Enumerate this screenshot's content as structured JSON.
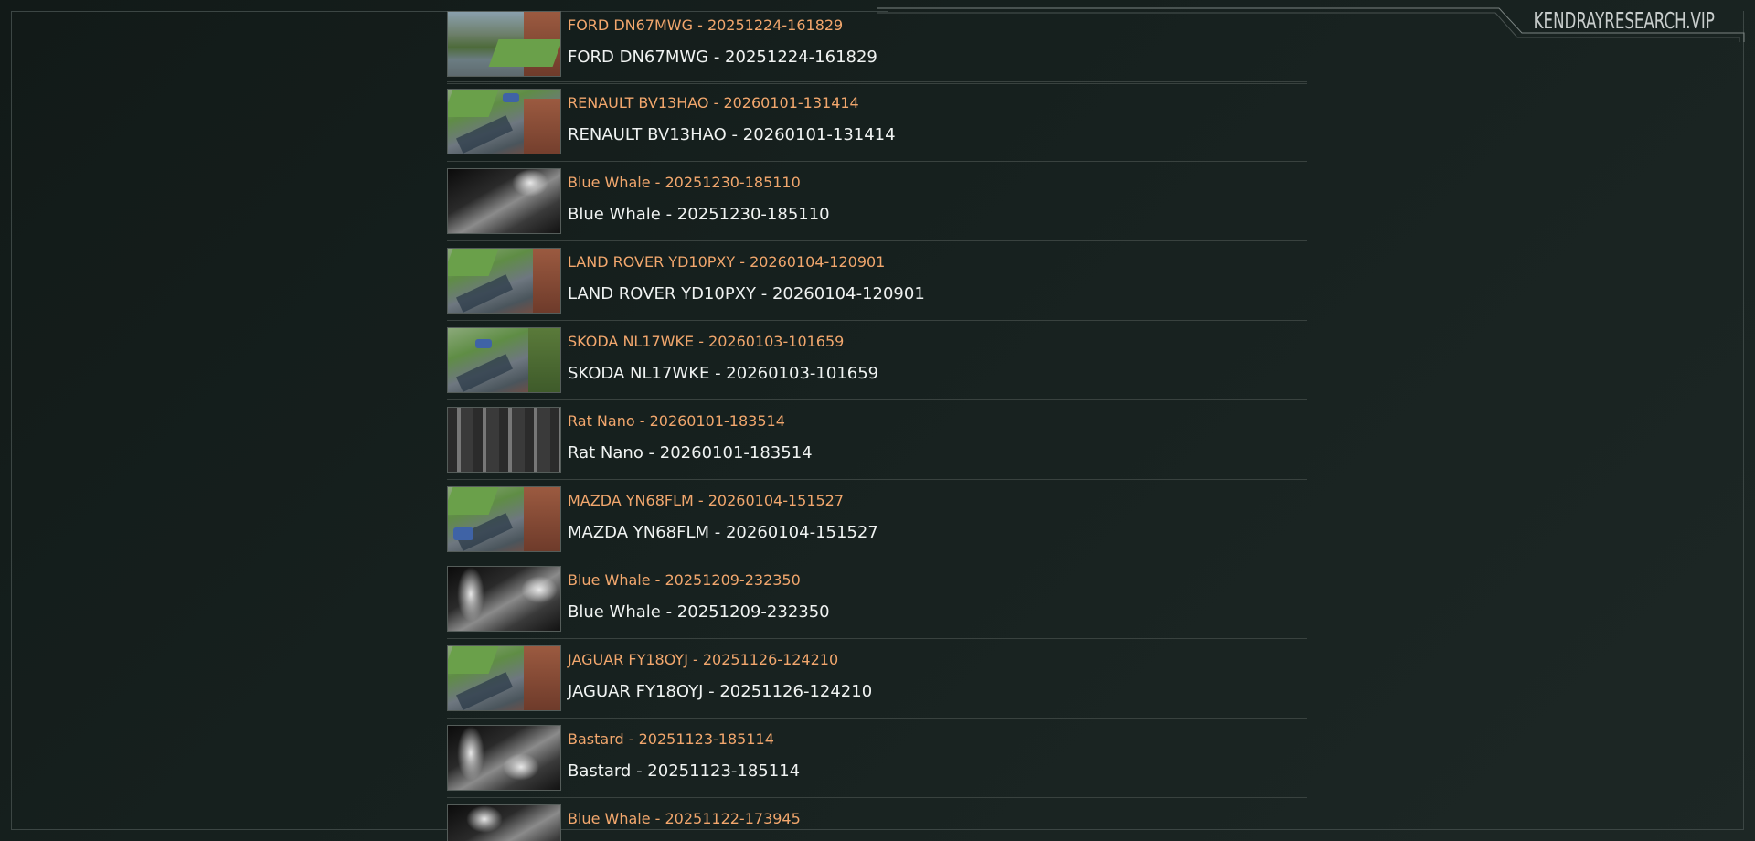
{
  "brand": {
    "text": "KENDRAYRESEARCH.VIP"
  },
  "colors": {
    "link": "#f2a76d",
    "text": "#f0f3f2",
    "background": "#16201e"
  },
  "items": [
    {
      "title": "FORD DN67MWG - 20251224-161829",
      "subtitle": "FORD DN67MWG - 20251224-161829",
      "thumb": "day-driveway"
    },
    {
      "title": "RENAULT BV13HAO - 20260101-131414",
      "subtitle": "RENAULT BV13HAO - 20260101-131414",
      "thumb": "day-street"
    },
    {
      "title": "Blue Whale - 20251230-185110",
      "subtitle": "Blue Whale - 20251230-185110",
      "thumb": "night-street"
    },
    {
      "title": "LAND ROVER YD10PXY - 20260104-120901",
      "subtitle": "LAND ROVER YD10PXY - 20260104-120901",
      "thumb": "day-street"
    },
    {
      "title": "SKODA NL17WKE - 20260103-101659",
      "subtitle": "SKODA NL17WKE - 20260103-101659",
      "thumb": "day-street"
    },
    {
      "title": "Rat Nano - 20260101-183514",
      "subtitle": "Rat Nano - 20260101-183514",
      "thumb": "night-shed"
    },
    {
      "title": "MAZDA YN68FLM - 20260104-151527",
      "subtitle": "MAZDA YN68FLM - 20260104-151527",
      "thumb": "day-street"
    },
    {
      "title": "Blue Whale - 20251209-232350",
      "subtitle": "Blue Whale - 20251209-232350",
      "thumb": "night-street"
    },
    {
      "title": "JAGUAR FY18OYJ - 20251126-124210",
      "subtitle": "JAGUAR FY18OYJ - 20251126-124210",
      "thumb": "day-street"
    },
    {
      "title": "Bastard - 20251123-185114",
      "subtitle": "Bastard - 20251123-185114",
      "thumb": "night-street"
    },
    {
      "title": "Blue Whale - 20251122-173945",
      "subtitle": "",
      "thumb": "night-street"
    }
  ]
}
